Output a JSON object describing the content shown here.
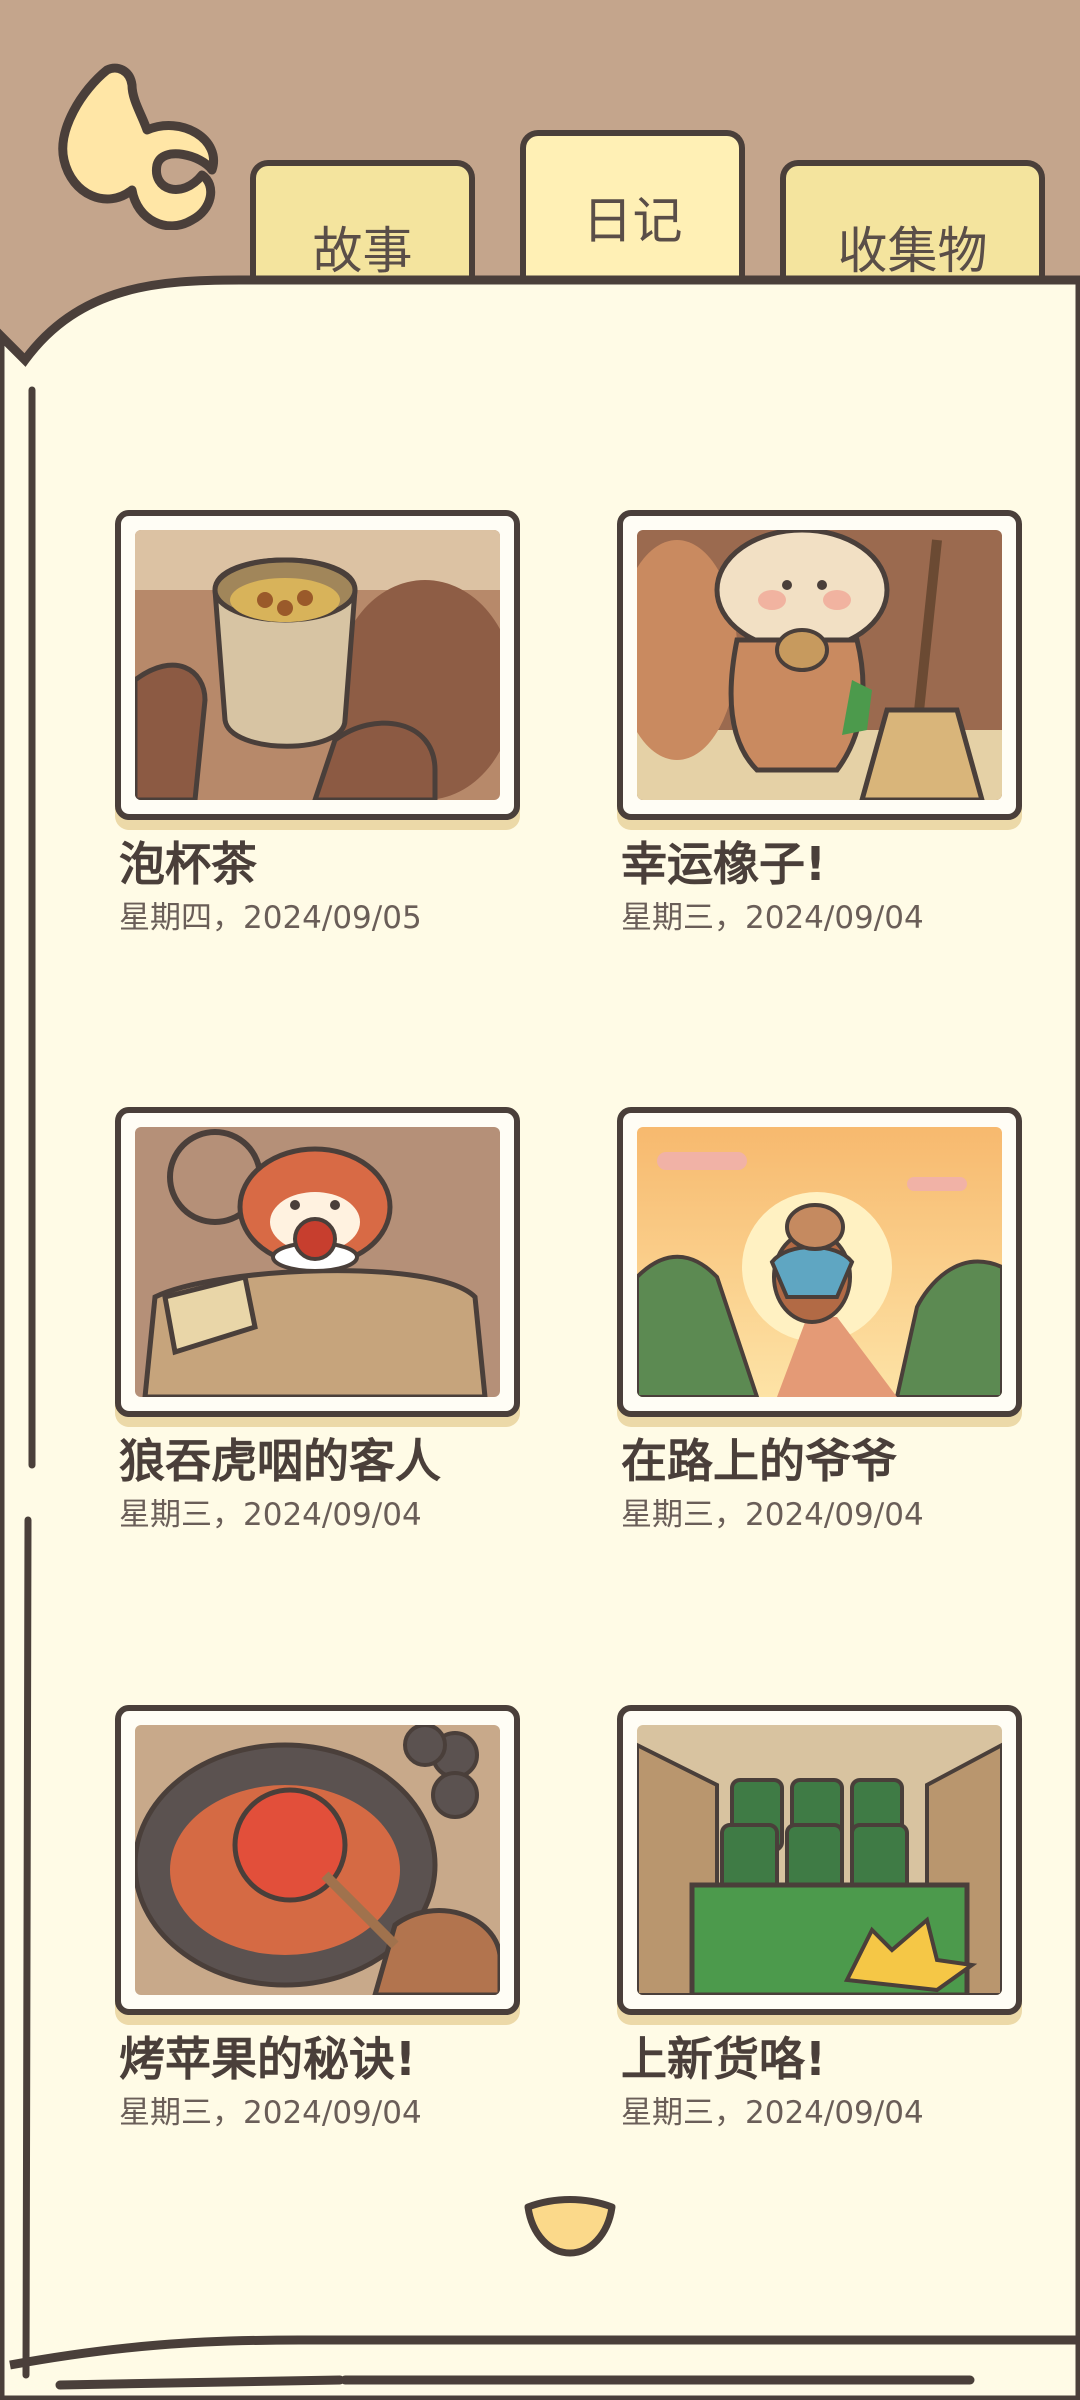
{
  "tabs": [
    {
      "label": "故事",
      "active": false
    },
    {
      "label": "日记",
      "active": true
    },
    {
      "label": "收集物",
      "active": false
    }
  ],
  "entries": [
    {
      "title": "泡杯茶",
      "date": "星期四，2024/09/05"
    },
    {
      "title": "幸运橡子!",
      "date": "星期三，2024/09/04"
    },
    {
      "title": "狼吞虎咽的客人",
      "date": "星期三，2024/09/04"
    },
    {
      "title": "在路上的爷爷",
      "date": "星期三，2024/09/04"
    },
    {
      "title": "烤苹果的秘诀!",
      "date": "星期三，2024/09/04"
    },
    {
      "title": "上新货咯!",
      "date": "星期三，2024/09/04"
    }
  ],
  "colors": {
    "background": "#c4a58c",
    "page": "#fffbe6",
    "outline": "#4a3f3a",
    "tab": "#f4e49e"
  }
}
